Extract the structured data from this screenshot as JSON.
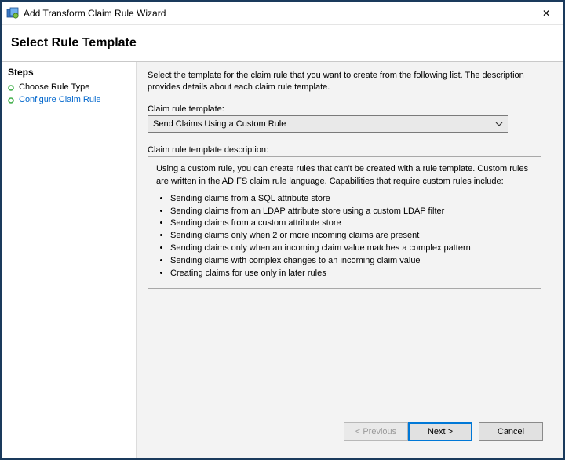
{
  "window": {
    "title": "Add Transform Claim Rule Wizard",
    "close_glyph": "✕"
  },
  "header": {
    "title": "Select Rule Template"
  },
  "sidebar": {
    "header": "Steps",
    "items": [
      {
        "label": "Choose Rule Type"
      },
      {
        "label": "Configure Claim Rule"
      }
    ]
  },
  "content": {
    "intro": "Select the template for the claim rule that you want to create from the following list. The description provides details about each claim rule template.",
    "template_label": "Claim rule template:",
    "template_selected": "Send Claims Using a Custom Rule",
    "desc_label": "Claim rule template description:",
    "desc_intro": "Using a custom rule, you can create rules that can't be created with a rule template.  Custom rules are written in the AD FS claim rule language.  Capabilities that require custom rules include:",
    "desc_items": [
      "Sending claims from a SQL attribute store",
      "Sending claims from an LDAP attribute store using a custom LDAP filter",
      "Sending claims from a custom attribute store",
      "Sending claims only when 2 or more incoming claims are present",
      "Sending claims only when an incoming claim value matches a complex pattern",
      "Sending claims with complex changes to an incoming claim value",
      "Creating claims for use only in later rules"
    ]
  },
  "footer": {
    "previous": "< Previous",
    "next": "Next >",
    "cancel": "Cancel"
  }
}
